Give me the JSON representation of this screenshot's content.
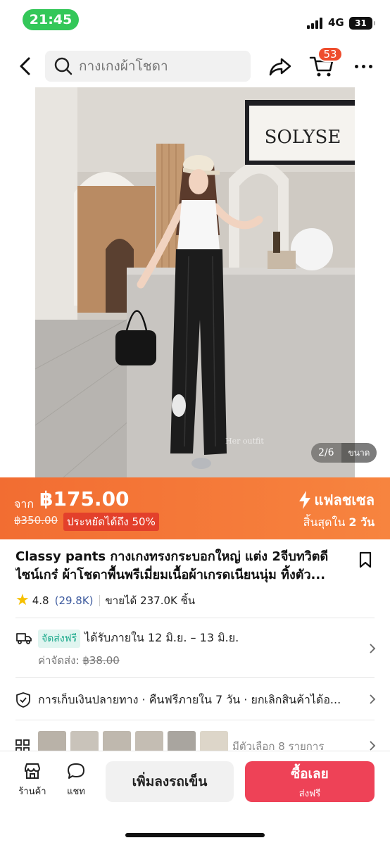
{
  "status_bar": {
    "time": "21:45",
    "network": "4G",
    "battery": "31"
  },
  "nav": {
    "search_placeholder": "กางเกงผ้าโชดา",
    "cart_count": "53"
  },
  "gallery": {
    "counter": "2/6",
    "size_label": "ขนาด",
    "watermark": "Her outfit",
    "sign_text": "SOLYSE"
  },
  "flash_sale": {
    "from_label": "จาก",
    "price": "฿175.00",
    "original_price": "฿350.00",
    "savings": "ประหยัดได้ถึง 50%",
    "title": "แฟลชเซล",
    "ends_prefix": "สิ้นสุดใน",
    "ends_value": "2 วัน"
  },
  "product": {
    "title": "Classy pants กางเกงทรงกระบอกใหญ่ แต่ง 2จีบทวิตดีไซน์เกร๋ ผ้าโชดาพื้นพรีเมี่ยมเนื้อผ้าเกรดเนียนนุ่ม ทิ้งตัว...",
    "rating": "4.8",
    "rating_count": "(29.8K)",
    "sold": "ขายได้ 237.0K ชิ้น"
  },
  "shipping": {
    "free_tag": "จัดส่งฟรี",
    "eta": "ได้รับภายใน 12 มิ.ย. – 13 มิ.ย.",
    "fee_label": "ค่าจัดส่ง:",
    "fee_original": "฿38.00"
  },
  "services": {
    "text": "การเก็บเงินปลายทาง · คืนฟรีภายใน 7 วัน · ยกเลิกสินค้าได้อ..."
  },
  "variants": {
    "text": "มีตัวเลือก 8 รายการ"
  },
  "bottom_bar": {
    "shop_label": "ร้านค้า",
    "chat_label": "แชท",
    "add_to_cart": "เพิ่มลงรถเข็น",
    "buy_now": "ซื้อเลย",
    "buy_now_sub": "ส่งฟรี"
  },
  "colors": {
    "flash_orange": "#f26d32",
    "buy_red": "#ee4257",
    "badge_red": "#ee4d2d",
    "free_green": "#1aa98b"
  }
}
